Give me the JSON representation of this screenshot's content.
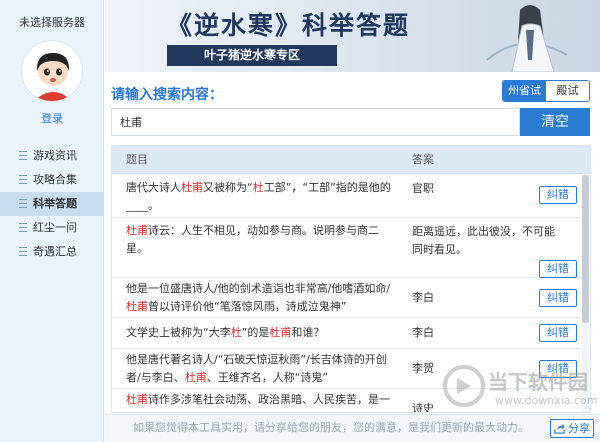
{
  "sidebar": {
    "server_status": "未选择服务器",
    "login": "登录",
    "nav": [
      {
        "label": "游戏资讯",
        "active": false
      },
      {
        "label": "攻略合集",
        "active": false
      },
      {
        "label": "科举答题",
        "active": true
      },
      {
        "label": "红尘一问",
        "active": false
      },
      {
        "label": "奇遇汇总",
        "active": false
      }
    ]
  },
  "banner": {
    "title": "《逆水寒》科举答题",
    "subtitle": "叶子猪逆水寒专区"
  },
  "search": {
    "label": "请输入搜索内容：",
    "value": "杜甫",
    "clear_label": "清空",
    "tabs": [
      {
        "label": "州省试",
        "active": true
      },
      {
        "label": "殿试",
        "active": false
      }
    ]
  },
  "table": {
    "col_question": "题目",
    "col_answer": "答案",
    "fix_label": "纠错",
    "rows": [
      {
        "q1": "唐代大诗人",
        "h1": "杜甫",
        "q2": "又被称为“",
        "h2": "杜",
        "q3": "工部”，“工部”指的是他的____。",
        "answer": "官职"
      },
      {
        "q1": "",
        "h1": "杜甫",
        "q2": "诗云：人生不相见，动如参与商。说明参与商二星。",
        "h2": "",
        "q3": "",
        "answer": "距离遥远，此出彼没，不可能同时看见。"
      },
      {
        "q1": "他是一位盛唐诗人/他的剑术造诣也非常高/他嗜酒如命/",
        "h1": "杜甫",
        "q2": "曾以诗评价他“笔落惊风雨，诗成泣鬼神”",
        "h2": "",
        "q3": "",
        "answer": "李白"
      },
      {
        "q1": "文学史上被称为“大李",
        "h1": "杜",
        "q2": "”的是",
        "h2": "杜甫",
        "q3": "和谁？",
        "answer": "李白"
      },
      {
        "q1": "他是唐代著名诗人/“石破天惊逗秋雨”/长吉体诗的开创者/与李白、",
        "h1": "杜甫",
        "q2": "、王维齐名，人称“诗鬼”",
        "h2": "",
        "q3": "",
        "answer": "李贺"
      },
      {
        "q1": "",
        "h1": "杜甫",
        "q2": "诗作多涉笔社会动荡、政治黑暗、人民疾苦，是一",
        "h2": "",
        "q3": "",
        "answer": "诗史"
      }
    ]
  },
  "footer": {
    "message": "如果您觉得本工具实用，请分享给您的朋友，您的满意，是我们更新的最大动力。",
    "share_label": "分享"
  },
  "watermark": {
    "text": "当下软件园",
    "url": "www.downxia.com"
  },
  "colors": {
    "accent": "#2a7bd4",
    "highlight": "#e8302a",
    "sidebar_bg": "#e8f3fb"
  }
}
